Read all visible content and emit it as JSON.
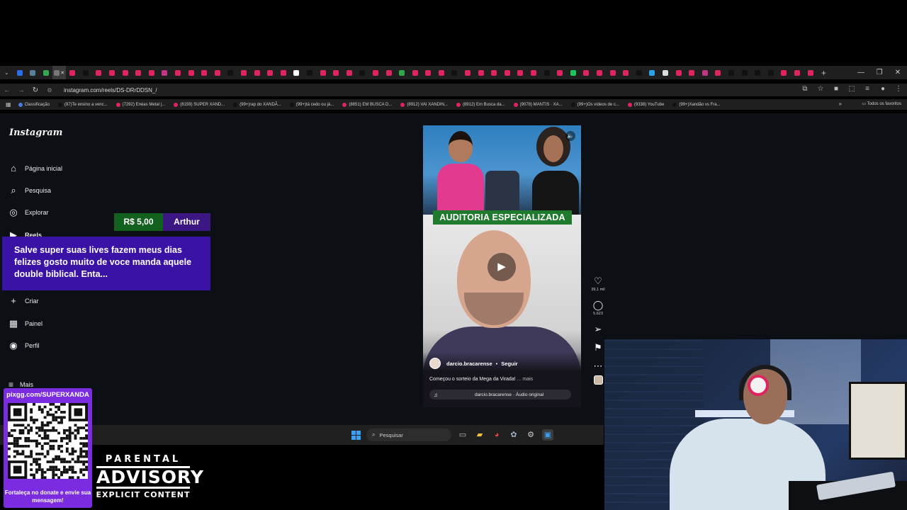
{
  "browser": {
    "tabs": [
      {
        "color": "#2b6de6"
      },
      {
        "color": "#5a7f9c"
      },
      {
        "color": "#33a852"
      },
      {
        "color": "#777777",
        "active": true,
        "close": "✕"
      },
      {
        "color": "#e0245e"
      },
      {
        "color": "#111111"
      },
      {
        "color": "#e0245e"
      },
      {
        "color": "#e0245e"
      },
      {
        "color": "#e0245e"
      },
      {
        "color": "#e0245e"
      },
      {
        "color": "#e0245e"
      },
      {
        "color": "#c13584"
      },
      {
        "color": "#e0245e"
      },
      {
        "color": "#e0245e"
      },
      {
        "color": "#e0245e"
      },
      {
        "color": "#e0245e"
      },
      {
        "color": "#111111"
      },
      {
        "color": "#e0245e"
      },
      {
        "color": "#e0245e"
      },
      {
        "color": "#e0245e"
      },
      {
        "color": "#e0245e"
      },
      {
        "color": "#ffffff"
      },
      {
        "color": "#111111"
      },
      {
        "color": "#e0245e"
      },
      {
        "color": "#e0245e"
      },
      {
        "color": "#e0245e"
      },
      {
        "color": "#111111"
      },
      {
        "color": "#e0245e"
      },
      {
        "color": "#e0245e"
      },
      {
        "color": "#2ea84a"
      },
      {
        "color": "#e0245e"
      },
      {
        "color": "#e0245e"
      },
      {
        "color": "#e0245e"
      },
      {
        "color": "#111111"
      },
      {
        "color": "#e0245e"
      },
      {
        "color": "#e0245e"
      },
      {
        "color": "#e0245e"
      },
      {
        "color": "#e0245e"
      },
      {
        "color": "#e0245e"
      },
      {
        "color": "#e0245e"
      },
      {
        "color": "#111111"
      },
      {
        "color": "#e0245e"
      },
      {
        "color": "#19c75b"
      },
      {
        "color": "#e0245e"
      },
      {
        "color": "#e0245e"
      },
      {
        "color": "#e0245e"
      },
      {
        "color": "#e0245e"
      },
      {
        "color": "#111111"
      },
      {
        "color": "#2aa1e3"
      },
      {
        "color": "#dddddd"
      },
      {
        "color": "#e0245e"
      },
      {
        "color": "#e0245e"
      },
      {
        "color": "#c13584"
      },
      {
        "color": "#e0245e"
      },
      {
        "color": "#111111"
      },
      {
        "color": "#111111"
      },
      {
        "color": "#111111"
      },
      {
        "color": "#111111"
      },
      {
        "color": "#e0245e"
      },
      {
        "color": "#e0245e"
      },
      {
        "color": "#e0245e"
      }
    ],
    "new_tab": "+",
    "window_controls": {
      "minimize": "—",
      "maximize": "❐",
      "close": "✕"
    },
    "url": "instagram.com/reels/DS-DRrDDSN_/",
    "nav": {
      "back": "←",
      "forward": "→",
      "reload": "↻",
      "site_info": "⚙"
    },
    "addr_icons": [
      "⧉",
      "☆",
      "■",
      "⬚",
      "≡",
      "●",
      "⋮"
    ],
    "bookmarks": [
      {
        "label": "Classificação",
        "color": "#4a7ae0"
      },
      {
        "label": "(97)Te ensino a venc...",
        "color": "#111111"
      },
      {
        "label": "(7292) Enéas Metal |...",
        "color": "#e0245e"
      },
      {
        "label": "(8159) SUPER XAND...",
        "color": "#e0245e"
      },
      {
        "label": "(99+)rap do XANDÃ...",
        "color": "#111111"
      },
      {
        "label": "(99+)tá cedo ou já...",
        "color": "#111111"
      },
      {
        "label": "(8851) EM BUSCA D...",
        "color": "#e0245e"
      },
      {
        "label": "(8912) VAI XANDIN...",
        "color": "#e0245e"
      },
      {
        "label": "(8912) Em Busca da...",
        "color": "#e0245e"
      },
      {
        "label": "(9078) MANTIS · XA...",
        "color": "#e0245e"
      },
      {
        "label": "(99+)Os vídeos de c...",
        "color": "#111111"
      },
      {
        "label": "(9338) YouTube",
        "color": "#e0245e"
      },
      {
        "label": "(99+)Xandão vs Fra...",
        "color": "#111111"
      }
    ],
    "bookmarks_overflow": "»",
    "all_favorites": "Todos os favoritos"
  },
  "instagram": {
    "logo": "Instagram",
    "nav": [
      {
        "icon": "⌂",
        "label": "Página inicial",
        "icon_name": "home-icon"
      },
      {
        "icon": "⌕",
        "label": "Pesquisa",
        "icon_name": "search-icon"
      },
      {
        "icon": "◎",
        "label": "Explorar",
        "icon_name": "compass-icon"
      },
      {
        "icon": "▶",
        "label": "Reels",
        "icon_name": "reels-icon",
        "bold": true
      },
      {
        "icon": "✉",
        "label": "",
        "icon_name": "messages-icon"
      },
      {
        "icon": "♡",
        "label": "",
        "icon_name": "notifications-icon"
      },
      {
        "icon": "+",
        "label": "Criar",
        "icon_name": "create-icon"
      },
      {
        "icon": "▦",
        "label": "Painel",
        "icon_name": "dashboard-icon"
      },
      {
        "icon": "◉",
        "label": "Perfil",
        "icon_name": "profile-icon"
      }
    ],
    "more": {
      "icon": "≡",
      "label": "Mais"
    },
    "reel": {
      "banner": "AUDITORIA ESPECIALIZADA",
      "mute_icon": "🔈",
      "play_icon": "▶",
      "username": "darcio.bracarense",
      "separator": "•",
      "follow": "Seguir",
      "caption": "Começou o sorteio da Mega da Virada!",
      "caption_more": "... mais",
      "audio_icon": "♫",
      "audio": "darcio.bracarense · Áudio original"
    },
    "actions": {
      "like_icon": "♡",
      "likes": "39,1 mil",
      "comment_icon": "◯",
      "comments": "5.623",
      "share_icon": "➢",
      "save_icon": "⚑",
      "more_icon": "⋯"
    }
  },
  "taskbar": {
    "search_icon": "⌕",
    "search_placeholder": "Pesquisar",
    "apps": [
      "▭",
      "▰",
      "◕",
      "✿",
      "⚙",
      "▣"
    ]
  },
  "overlays": {
    "donation_amount": "R$ 5,00",
    "donation_name": "Arthur",
    "donation_message": "Salve super suas lives fazem meus dias felizes gosto muito de voce manda aquele double biblical. Enta...",
    "qr_url": "pixgg.com/SUPERXANDA",
    "qr_caption": "Fortaleça no donate e envie sua mensagem!",
    "advisory_top": "PARENTAL",
    "advisory_mid": "ADVISORY",
    "advisory_bot": "EXPLICIT CONTENT"
  }
}
